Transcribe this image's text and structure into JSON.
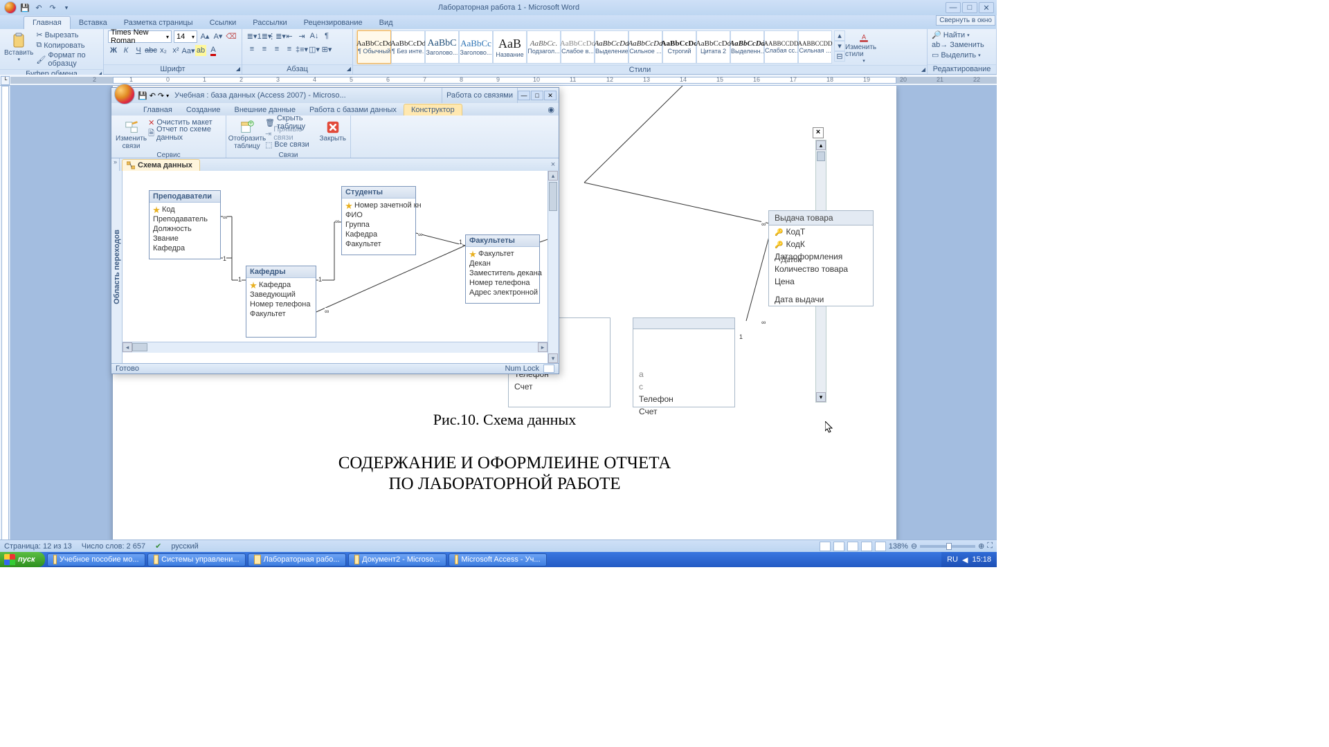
{
  "word": {
    "title": "Лабораторная работа 1 - Microsoft Word",
    "corner_btn": "Свернуть в окно",
    "tabs": [
      "Главная",
      "Вставка",
      "Разметка страницы",
      "Ссылки",
      "Рассылки",
      "Рецензирование",
      "Вид"
    ],
    "active_tab": 0,
    "clipboard": {
      "paste": "Вставить",
      "cut": "Вырезать",
      "copy": "Копировать",
      "format": "Формат по образцу",
      "label": "Буфер обмена"
    },
    "font": {
      "name": "Times New Roman",
      "size": "14",
      "label": "Шрифт"
    },
    "para": {
      "label": "Абзац"
    },
    "styles_label": "Стили",
    "change_styles": "Изменить стили",
    "styles": [
      {
        "preview": "AaBbCcDd",
        "name": "¶ Обычный"
      },
      {
        "preview": "AaBbCcDd",
        "name": "¶ Без инте..."
      },
      {
        "preview": "AaBbC",
        "name": "Заголово..."
      },
      {
        "preview": "AaBbCc",
        "name": "Заголово..."
      },
      {
        "preview": "AaB",
        "name": "Название"
      },
      {
        "preview": "AaBbCc.",
        "name": "Подзагол..."
      },
      {
        "preview": "AaBbCcDd",
        "name": "Слабое в..."
      },
      {
        "preview": "AaBbCcDd",
        "name": "Выделение"
      },
      {
        "preview": "AaBbCcDd",
        "name": "Сильное ..."
      },
      {
        "preview": "AaBbCcDd",
        "name": "Строгий"
      },
      {
        "preview": "AaBbCcDd",
        "name": "Цитата 2"
      },
      {
        "preview": "AaBbCcDd",
        "name": "Выделенн..."
      },
      {
        "preview": "AABBCCDD",
        "name": "Слабая сс..."
      },
      {
        "preview": "AABBCCDD",
        "name": "Сильная ..."
      }
    ],
    "editing": {
      "find": "Найти",
      "replace": "Заменить",
      "select": "Выделить",
      "label": "Редактирование"
    },
    "status": {
      "page": "Страница: 12 из 13",
      "words": "Число слов: 2 657",
      "lang": "русский",
      "zoom": "138%"
    },
    "doc": {
      "figure_caption": "Рис.10. Схема данных",
      "heading1": "СОДЕРЖАНИЕ И ОФОРМЛЕИНЕ ОТЧЕТА",
      "heading2": "ПО ЛАБОРАТОРНОЙ РАБОТЕ",
      "visible_tables": {
        "vydacha": {
          "title": "Выдача товара",
          "fields": [
            "КодТ",
            "КодК",
            "Датаоформления",
            "Количество товара",
            "Цена",
            "Дата выдачи"
          ],
          "keys": [
            0,
            1
          ]
        },
        "partial_left": {
          "fields": [
            "Телефон",
            "Счет"
          ]
        },
        "partial_right": {
          "fields": [
            "Телефон",
            "Счет"
          ]
        }
      }
    }
  },
  "access": {
    "title": "Учебная : база данных (Access 2007) - Microso...",
    "context_group": "Работа со связями",
    "tabs": [
      "Главная",
      "Создание",
      "Внешние данные",
      "Работа с базами данных"
    ],
    "context_tab": "Конструктор",
    "ribbon": {
      "edit": {
        "btn": "Изменить связи",
        "clear": "Очистить макет",
        "report": "Отчет по схеме данных",
        "label": "Сервис"
      },
      "show": {
        "btn": "Отобразить таблицу",
        "hide": "Скрыть таблицу",
        "direct": "Прямые связи",
        "all": "Все связи",
        "label": "Связи"
      },
      "close": "Закрыть"
    },
    "nav": "Область переходов",
    "schema_tab": "Схема данных",
    "tables": {
      "teachers": {
        "title": "Преподаватели",
        "fields": [
          "Код",
          "Преподаватель",
          "Должность",
          "Звание",
          "Кафедра"
        ],
        "keys": [
          0
        ]
      },
      "depts": {
        "title": "Кафедры",
        "fields": [
          "Кафедра",
          "Заведующий",
          "Номер телефона",
          "Факультет"
        ],
        "keys": [
          0
        ]
      },
      "students": {
        "title": "Студенты",
        "fields": [
          "Номер зачетной кн",
          "ФИО",
          "Группа",
          "Кафедра",
          "Факультет"
        ],
        "keys": [
          0
        ]
      },
      "fac": {
        "title": "Факультеты",
        "fields": [
          "Факультет",
          "Декан",
          "Заместитель декана",
          "Номер телефона",
          "Адрес электронной"
        ],
        "keys": [
          0
        ]
      }
    },
    "status": {
      "ready": "Готово",
      "numlock": "Num Lock"
    }
  },
  "taskbar": {
    "start": "пуск",
    "items": [
      "Учебное пособие мо...",
      "Системы управлени...",
      "Лабораторная рабо...",
      "Документ2 - Microso...",
      "Microsoft Access - Уч..."
    ],
    "lang": "RU",
    "time": "15:18"
  },
  "overlap_text": "Даток"
}
